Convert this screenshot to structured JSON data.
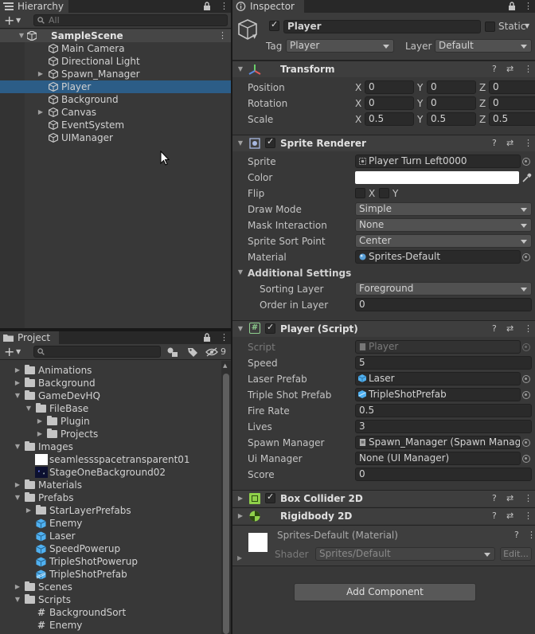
{
  "hierarchy": {
    "tab": "Hierarchy",
    "search_placeholder": "All",
    "scene": "SampleScene",
    "items": [
      {
        "label": "Main Camera",
        "foldable": false,
        "selected": false
      },
      {
        "label": "Directional Light",
        "foldable": false,
        "selected": false
      },
      {
        "label": "Spawn_Manager",
        "foldable": true,
        "selected": false
      },
      {
        "label": "Player",
        "foldable": false,
        "selected": true
      },
      {
        "label": "Background",
        "foldable": false,
        "selected": false
      },
      {
        "label": "Canvas",
        "foldable": true,
        "selected": false
      },
      {
        "label": "EventSystem",
        "foldable": false,
        "selected": false
      },
      {
        "label": "UIManager",
        "foldable": false,
        "selected": false
      }
    ]
  },
  "project": {
    "tab": "Project",
    "hidden_count": "9",
    "items": [
      {
        "label": "Animations",
        "kind": "folder",
        "depth": 0,
        "fold": "closed"
      },
      {
        "label": "Background",
        "kind": "folder",
        "depth": 0,
        "fold": "closed"
      },
      {
        "label": "GameDevHQ",
        "kind": "folder",
        "depth": 0,
        "fold": "open"
      },
      {
        "label": "FileBase",
        "kind": "folder",
        "depth": 1,
        "fold": "open"
      },
      {
        "label": "Plugin",
        "kind": "folder",
        "depth": 2,
        "fold": "closed"
      },
      {
        "label": "Projects",
        "kind": "folder",
        "depth": 2,
        "fold": "closed"
      },
      {
        "label": "Images",
        "kind": "folder",
        "depth": 0,
        "fold": "open"
      },
      {
        "label": "seamlessspacetransparent01",
        "kind": "image-white",
        "depth": 1,
        "fold": "none"
      },
      {
        "label": "StageOneBackground02",
        "kind": "image-dark",
        "depth": 1,
        "fold": "none"
      },
      {
        "label": "Materials",
        "kind": "folder",
        "depth": 0,
        "fold": "closed"
      },
      {
        "label": "Prefabs",
        "kind": "folder",
        "depth": 0,
        "fold": "open"
      },
      {
        "label": "StarLayerPrefabs",
        "kind": "folder",
        "depth": 1,
        "fold": "closed"
      },
      {
        "label": "Enemy",
        "kind": "prefab",
        "depth": 1,
        "fold": "none"
      },
      {
        "label": "Laser",
        "kind": "prefab",
        "depth": 1,
        "fold": "none"
      },
      {
        "label": "SpeedPowerup",
        "kind": "prefab",
        "depth": 1,
        "fold": "none"
      },
      {
        "label": "TripleShotPowerup",
        "kind": "prefab",
        "depth": 1,
        "fold": "none"
      },
      {
        "label": "TripleShotPrefab",
        "kind": "prefab-variant",
        "depth": 1,
        "fold": "none"
      },
      {
        "label": "Scenes",
        "kind": "folder",
        "depth": 0,
        "fold": "closed"
      },
      {
        "label": "Scripts",
        "kind": "folder",
        "depth": 0,
        "fold": "open"
      },
      {
        "label": "BackgroundSort",
        "kind": "script",
        "depth": 1,
        "fold": "none"
      },
      {
        "label": "Enemy",
        "kind": "script",
        "depth": 1,
        "fold": "none"
      }
    ]
  },
  "inspector": {
    "tab": "Inspector",
    "object_name": "Player",
    "static_label": "Static",
    "tag_label": "Tag",
    "tag_value": "Player",
    "layer_label": "Layer",
    "layer_value": "Default",
    "transform": {
      "title": "Transform",
      "rows": [
        {
          "label": "Position",
          "x": "0",
          "y": "0",
          "z": "0"
        },
        {
          "label": "Rotation",
          "x": "0",
          "y": "0",
          "z": "0"
        },
        {
          "label": "Scale",
          "x": "0.5",
          "y": "0.5",
          "z": "0.5"
        }
      ],
      "axes": [
        "X",
        "Y",
        "Z"
      ]
    },
    "sprite_renderer": {
      "title": "Sprite Renderer",
      "sprite_label": "Sprite",
      "sprite_value": "Player Turn Left0000",
      "color_label": "Color",
      "color_value": "#ffffff",
      "flip_label": "Flip",
      "flip_x": "X",
      "flip_y": "Y",
      "draw_mode_label": "Draw Mode",
      "draw_mode_value": "Simple",
      "mask_label": "Mask Interaction",
      "mask_value": "None",
      "sort_point_label": "Sprite Sort Point",
      "sort_point_value": "Center",
      "material_label": "Material",
      "material_value": "Sprites-Default",
      "additional_label": "Additional Settings",
      "sorting_layer_label": "Sorting Layer",
      "sorting_layer_value": "Foreground",
      "order_label": "Order in Layer",
      "order_value": "0"
    },
    "player_script": {
      "title": "Player (Script)",
      "script_label": "Script",
      "script_value": "Player",
      "speed_label": "Speed",
      "speed_value": "5",
      "laser_label": "Laser Prefab",
      "laser_value": "Laser",
      "triple_label": "Triple Shot Prefab",
      "triple_value": "TripleShotPrefab",
      "fire_label": "Fire Rate",
      "fire_value": "0.5",
      "lives_label": "Lives",
      "lives_value": "3",
      "spawn_label": "Spawn Manager",
      "spawn_value": "Spawn_Manager (Spawn Manager)",
      "ui_label": "Ui Manager",
      "ui_value": "None (UI Manager)",
      "score_label": "Score",
      "score_value": "0"
    },
    "box_collider": {
      "title": "Box Collider 2D"
    },
    "rigidbody": {
      "title": "Rigidbody 2D"
    },
    "material": {
      "title": "Sprites-Default (Material)",
      "shader_label": "Shader",
      "shader_value": "Sprites/Default",
      "edit_label": "Edit..."
    },
    "add_component": "Add Component"
  },
  "colors": {
    "selection": "#2c5d87",
    "panel": "#383838",
    "prefab_blue": "#4fb0f0",
    "script_icon": "#4ca35a"
  }
}
